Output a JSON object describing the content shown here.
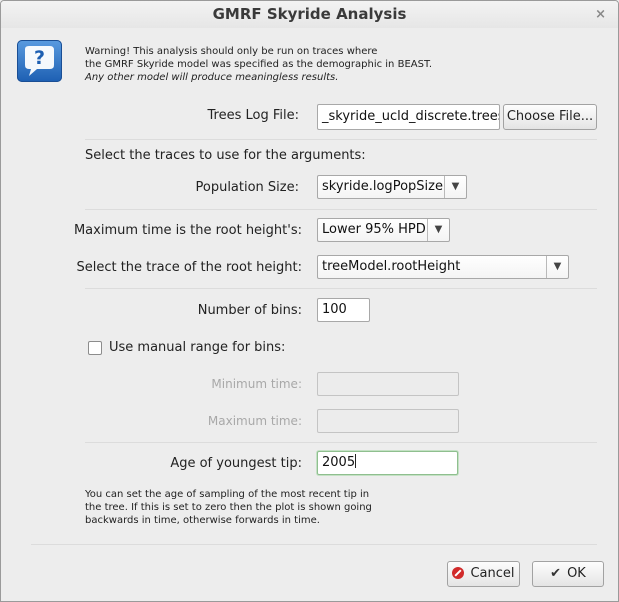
{
  "window": {
    "title": "GMRF Skyride Analysis",
    "close_glyph": "×"
  },
  "warning": {
    "icon": "question-icon",
    "line1": "Warning! This analysis should only be run on traces where",
    "line2": "the GMRF Skyride model was specified as the demographic in BEAST.",
    "line3": "Any other model will produce meaningless results."
  },
  "trees_log": {
    "label": "Trees Log File:",
    "value": "_skyride_ucld_discrete.trees",
    "choose_label": "Choose File..."
  },
  "traces_heading": "Select the traces to use for the arguments:",
  "population_size": {
    "label": "Population Size:",
    "value": "skyride.logPopSize"
  },
  "max_time": {
    "label": "Maximum time is the root height's:",
    "value": "Lower 95% HPD"
  },
  "root_height": {
    "label": "Select the trace of the root height:",
    "value": "treeModel.rootHeight"
  },
  "bins": {
    "label": "Number of bins:",
    "value": "100"
  },
  "manual_range": {
    "label": "Use manual range for bins:",
    "checked": false
  },
  "min_time": {
    "label": "Minimum time:",
    "value": ""
  },
  "max_time_field": {
    "label": "Maximum time:",
    "value": ""
  },
  "youngest_tip": {
    "label": "Age of youngest tip:",
    "value": "2005"
  },
  "note": {
    "line1": "You can set the age of sampling of the most recent tip in",
    "line2": "the tree. If this is set to zero then the plot is shown going",
    "line3": "backwards in time, otherwise forwards in time."
  },
  "buttons": {
    "cancel": "Cancel",
    "ok": "OK"
  },
  "dropdown_arrow": "▼"
}
